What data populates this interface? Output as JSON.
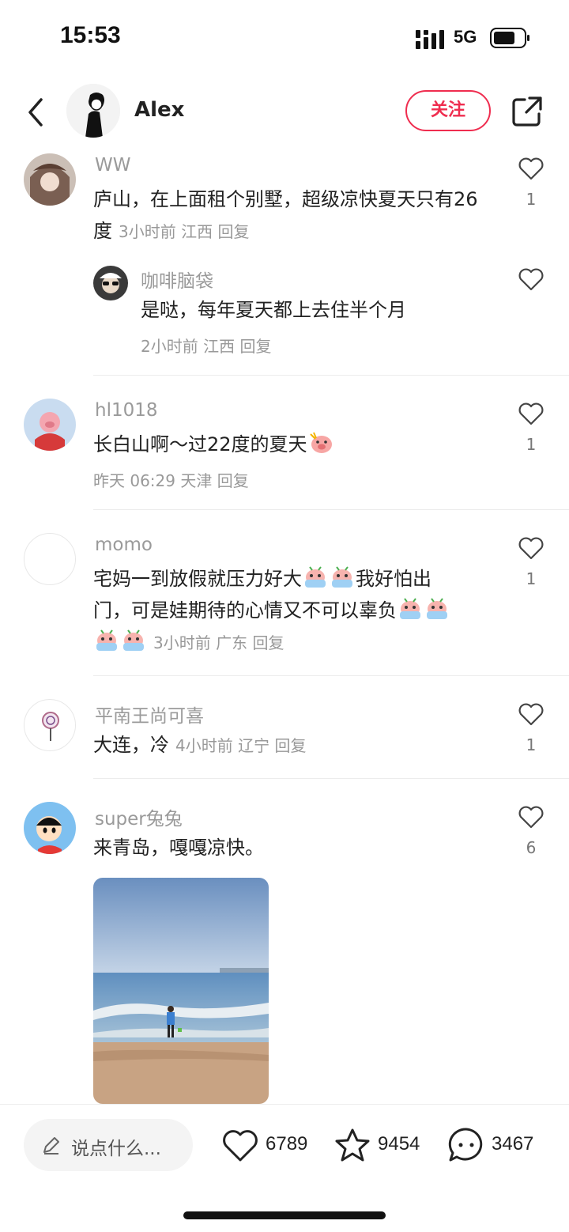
{
  "status": {
    "time": "15:53",
    "network": "5G"
  },
  "header": {
    "author": "Alex",
    "follow_label": "关注"
  },
  "comments": [
    {
      "user": "WW",
      "text": "庐山，在上面租个别墅，超级凉快夏天只有26度",
      "meta": "3小时前 江西 回复",
      "likes": "1",
      "reply": {
        "user": "咖啡脑袋",
        "text": "是哒，每年夏天都上去住半个月",
        "meta": "2小时前 江西 回复"
      }
    },
    {
      "user": "hl1018",
      "text": "长白山啊～过22度的夏天",
      "meta": "昨天 06:29 天津 回复",
      "likes": "1"
    },
    {
      "user": "momo",
      "text_1": "宅妈一到放假就压力好大",
      "text_2": "我好怕出",
      "text_3": "门，可是娃期待的心情又不可以辜负",
      "meta": "3小时前 广东 回复",
      "likes": "1"
    },
    {
      "user": "平南王尚可喜",
      "text": "大连，冷",
      "meta": "4小时前 辽宁 回复",
      "likes": "1"
    },
    {
      "user": "super兔兔",
      "text": "来青岛，嘎嘎凉快。",
      "likes": "6"
    }
  ],
  "bottom": {
    "input_placeholder": "说点什么...",
    "likes": "6789",
    "favorites": "9454",
    "comments": "3467"
  },
  "colors": {
    "accent": "#ef2d4f"
  }
}
